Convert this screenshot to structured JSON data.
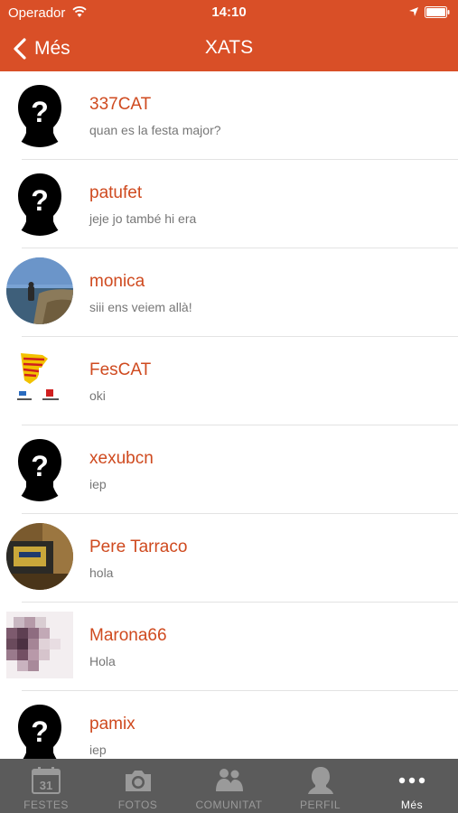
{
  "status_bar": {
    "carrier": "Operador",
    "time": "14:10"
  },
  "nav": {
    "back_label": "Més",
    "title": "XATS"
  },
  "chats": [
    {
      "name": "337CAT",
      "message": "quan es la festa major?",
      "avatar": "silhouette"
    },
    {
      "name": "patufet",
      "message": "jeje jo també hi era",
      "avatar": "silhouette"
    },
    {
      "name": "monica",
      "message": "siii ens veiem allà!",
      "avatar": "photo-coast"
    },
    {
      "name": "FesCAT",
      "message": "oki",
      "avatar": "logo-fescat"
    },
    {
      "name": "xexubcn",
      "message": "iep",
      "avatar": "silhouette"
    },
    {
      "name": "Pere Tarraco",
      "message": "hola",
      "avatar": "photo-bottle"
    },
    {
      "name": "Marona66",
      "message": "Hola",
      "avatar": "photo-pixelated"
    },
    {
      "name": "pamix",
      "message": "iep",
      "avatar": "silhouette"
    }
  ],
  "tabs": [
    {
      "label": "FESTES",
      "icon": "calendar-icon",
      "calendar_day": "31"
    },
    {
      "label": "FOTOS",
      "icon": "camera-icon"
    },
    {
      "label": "COMUNITAT",
      "icon": "community-icon"
    },
    {
      "label": "PERFIL",
      "icon": "profile-icon"
    },
    {
      "label": "Més",
      "icon": "more-icon",
      "active": true
    }
  ],
  "colors": {
    "accent": "#d94f27",
    "name_text": "#cf4a1f",
    "tab_bar": "#5b5b5b"
  }
}
